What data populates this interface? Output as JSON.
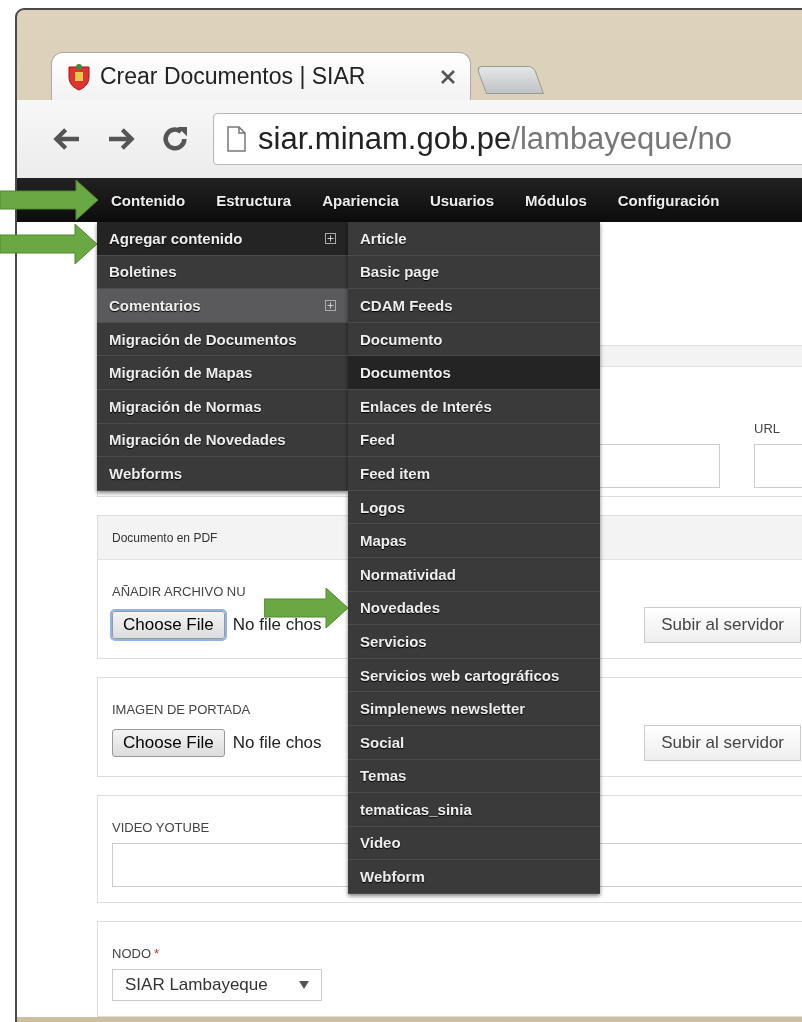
{
  "browser": {
    "tab_title": "Crear Documentos | SIAR",
    "url_host": "siar.minam.gob.pe",
    "url_path": "/lambayeque/no"
  },
  "admin_menu": [
    {
      "label": "Contenido"
    },
    {
      "label": "Estructura"
    },
    {
      "label": "Apariencia"
    },
    {
      "label": "Usuarios"
    },
    {
      "label": "Módulos"
    },
    {
      "label": "Configuración"
    }
  ],
  "content_menu": [
    {
      "label": "Agregar contenido",
      "has_submenu": true,
      "selected": true,
      "hovered": false
    },
    {
      "label": "Boletines",
      "has_submenu": false,
      "selected": false,
      "hovered": false
    },
    {
      "label": "Comentarios",
      "has_submenu": true,
      "selected": false,
      "hovered": true
    },
    {
      "label": "Migración de Documentos",
      "has_submenu": false,
      "selected": false,
      "hovered": false
    },
    {
      "label": "Migración de Mapas",
      "has_submenu": false,
      "selected": false,
      "hovered": false
    },
    {
      "label": "Migración de Normas",
      "has_submenu": false,
      "selected": false,
      "hovered": false
    },
    {
      "label": "Migración de Novedades",
      "has_submenu": false,
      "selected": false,
      "hovered": false
    },
    {
      "label": "Webforms",
      "has_submenu": false,
      "selected": false,
      "hovered": false
    }
  ],
  "add_content_menu": [
    {
      "label": "Article",
      "hovered": false
    },
    {
      "label": "Basic page",
      "hovered": false
    },
    {
      "label": "CDAM Feeds",
      "hovered": false
    },
    {
      "label": "Documento",
      "hovered": false
    },
    {
      "label": "Documentos",
      "hovered": true
    },
    {
      "label": "Enlaces de Interés",
      "hovered": false
    },
    {
      "label": "Feed",
      "hovered": false
    },
    {
      "label": "Feed item",
      "hovered": false
    },
    {
      "label": "Logos",
      "hovered": false
    },
    {
      "label": "Mapas",
      "hovered": false
    },
    {
      "label": "Normatividad",
      "hovered": false
    },
    {
      "label": "Novedades",
      "hovered": false
    },
    {
      "label": "Servicios",
      "hovered": false
    },
    {
      "label": "Servicios web cartográficos",
      "hovered": false
    },
    {
      "label": "Simplenews newsletter",
      "hovered": false
    },
    {
      "label": "Social",
      "hovered": false
    },
    {
      "label": "Temas",
      "hovered": false
    },
    {
      "label": "tematicas_sinia",
      "hovered": false
    },
    {
      "label": "Video",
      "hovered": false
    },
    {
      "label": "Webform",
      "hovered": false
    }
  ],
  "form": {
    "url_label": "URL",
    "pdf_panel": {
      "title": "Documento en PDF",
      "label": "AÑADIR ARCHIVO NU",
      "choose_button": "Choose File",
      "file_status": "No file chos",
      "upload_button": "Subir al servidor"
    },
    "cover_panel": {
      "label": "IMAGEN DE PORTADA",
      "choose_button": "Choose File",
      "file_status": "No file chos",
      "upload_button": "Subir al servidor"
    },
    "video_panel": {
      "label": "VIDEO YOTUBE"
    },
    "node_panel": {
      "label": "NODO",
      "required": true,
      "required_mark": "*",
      "value": "SIAR Lambayeque"
    }
  }
}
